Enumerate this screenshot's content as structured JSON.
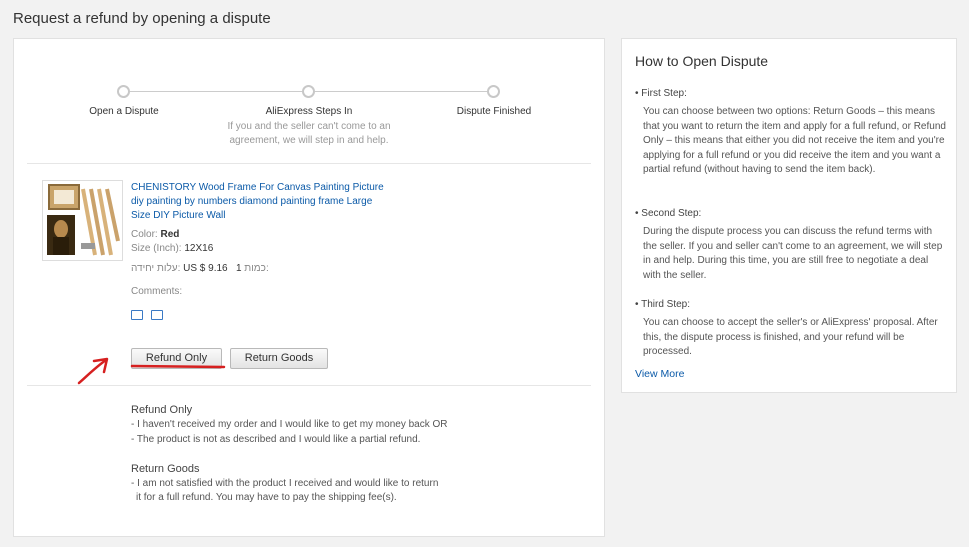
{
  "page": {
    "title": "Request a refund by opening a dispute"
  },
  "progress": {
    "steps": [
      {
        "label": "Open a Dispute"
      },
      {
        "label": "AliExpress Steps In",
        "note": "If you and the seller can't come to an agreement, we will step in and help."
      },
      {
        "label": "Dispute Finished"
      }
    ]
  },
  "product": {
    "title": "CHENISTORY Wood Frame For Canvas Painting Picture diy painting by numbers diamond painting frame Large Size DIY Picture Wall",
    "color_label": "Color:",
    "color_value": "Red",
    "size_label": "Size (Inch):",
    "size_value": "12X16",
    "unit_price_label": "עלות יחידה:",
    "unit_price_value": "US $ 9.16",
    "qty_label": "כמות:",
    "qty_value": "1",
    "comments_label": "Comments:"
  },
  "actions": {
    "refund_only": "Refund Only",
    "return_goods": "Return Goods"
  },
  "explanations": {
    "refund_only": {
      "heading": "Refund Only",
      "line1": "- I haven't received my order and I would like to get my money back OR",
      "line2": "- The product is not as described and I would like a partial refund."
    },
    "return_goods": {
      "heading": "Return Goods",
      "line1": "- I am not satisfied with the product I received and would like to return",
      "line2": "it for a full refund. You may have to pay the shipping fee(s)."
    }
  },
  "help": {
    "title": "How to Open Dispute",
    "steps": [
      {
        "title": "• First Step:",
        "text": "You can choose between two options: Return Goods – this means that you want to return the item and apply for a full refund, or Refund Only – this means that either you did not receive the item and you're applying for a full refund or you did receive the item and you want a partial refund (without having to send the item back)."
      },
      {
        "title": "• Second Step:",
        "text": "During the dispute process you can discuss the refund terms with the seller. If you and seller can't come to an agreement, we will step in and help. During this time, you are still free to negotiate a deal with the seller."
      },
      {
        "title": "• Third Step:",
        "text": "You can choose to accept the seller's or AliExpress' proposal. After this, the dispute process is finished, and your refund will be processed."
      }
    ],
    "view_more": "View More"
  },
  "colors": {
    "link": "#0b5aa8",
    "annotation": "#d62020"
  },
  "icons": {
    "attachment_1": "image-icon",
    "attachment_2": "file-icon",
    "annotation": "red-arrow-annotation"
  }
}
